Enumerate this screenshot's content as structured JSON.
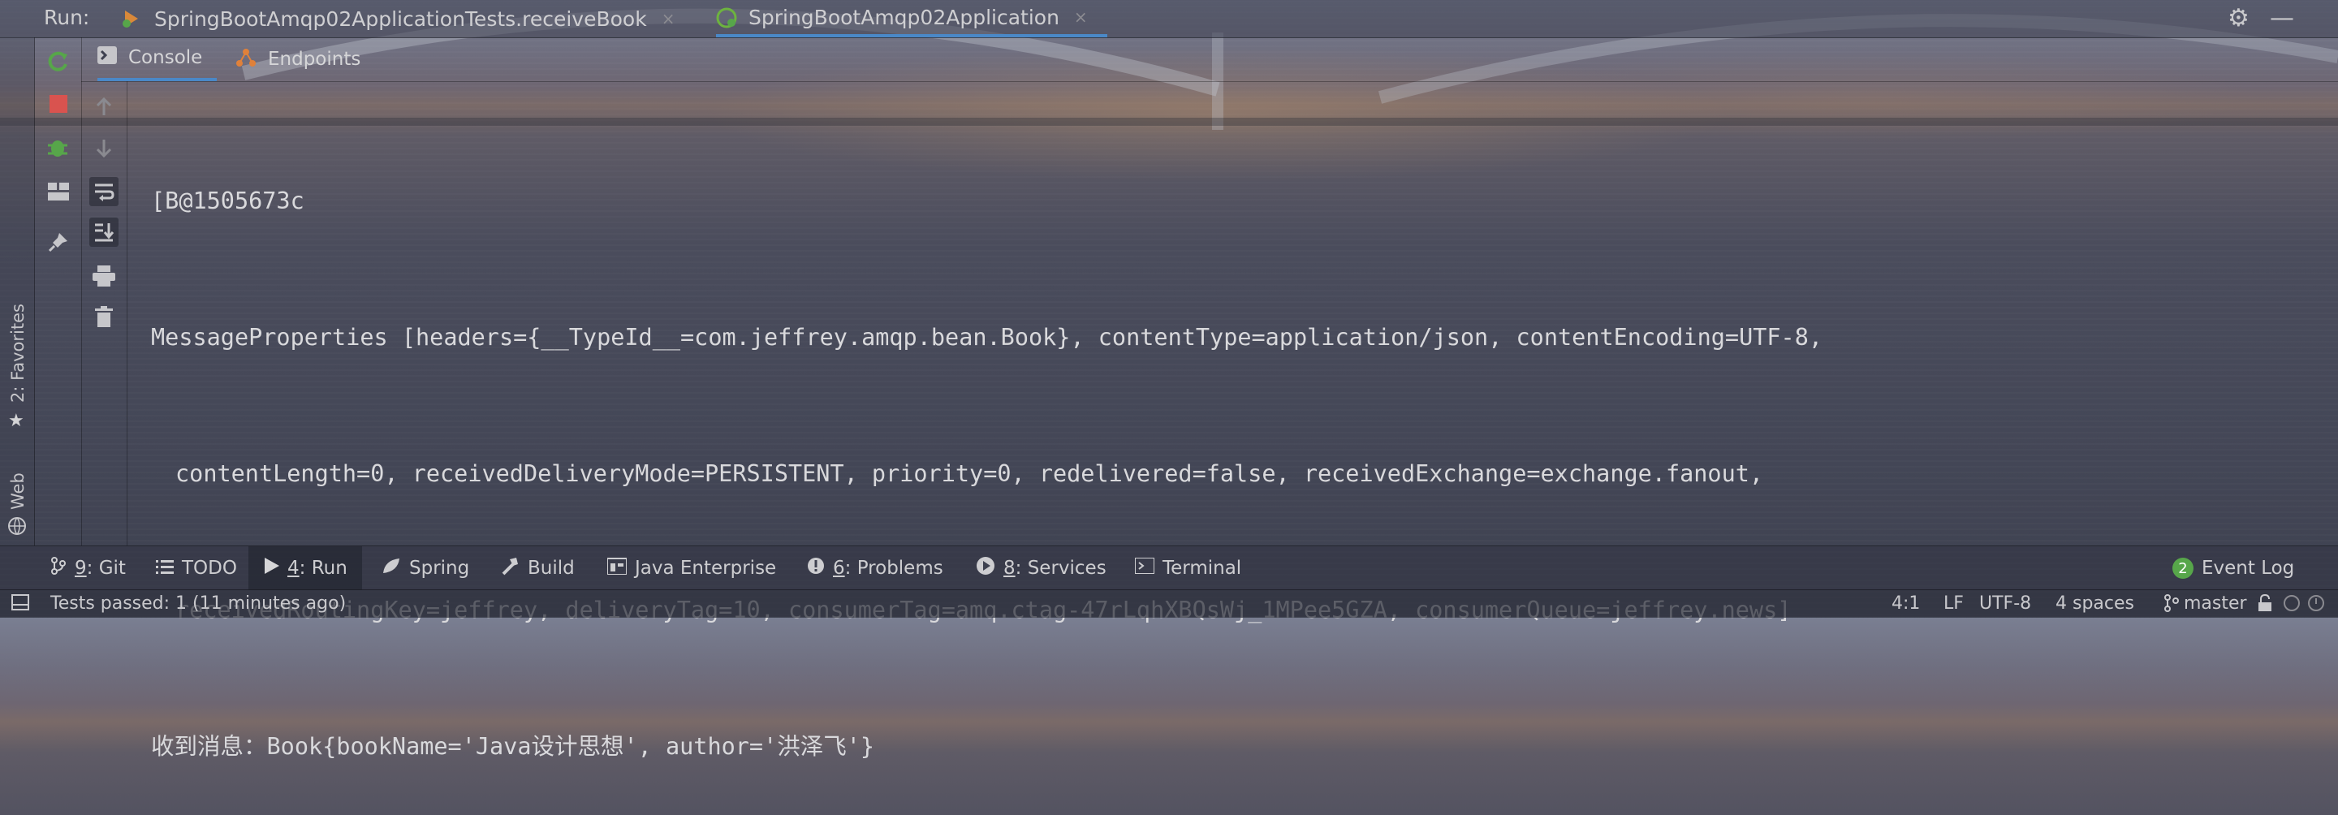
{
  "run_bar": {
    "label": "Run:",
    "tabs": [
      {
        "label": "SpringBootAmqp02ApplicationTests.receiveBook",
        "close": "×",
        "icon": "test-run-icon"
      },
      {
        "label": "SpringBootAmqp02Application",
        "close": "×",
        "icon": "spring-boot-icon",
        "active": true
      }
    ],
    "icons": [
      "gear-icon",
      "minimize-icon"
    ]
  },
  "console_tabs": [
    {
      "label": "Console",
      "icon": "console-icon",
      "active": true
    },
    {
      "label": "Endpoints",
      "icon": "endpoints-icon"
    }
  ],
  "favorites_bar": {
    "favorites": "2: Favorites",
    "web": "Web"
  },
  "console_lines": [
    "[B@1505673c",
    "MessageProperties [headers={__TypeId__=com.jeffrey.amqp.bean.Book}, contentType=application/json, contentEncoding=UTF-8,",
    "contentLength=0, receivedDeliveryMode=PERSISTENT, priority=0, redelivered=false, receivedExchange=exchange.fanout,",
    "receivedRoutingKey=jeffrey, deliveryTag=10, consumerTag=amq.ctag-47rLqhXBQsWj_1MPee5GZA, consumerQueue=jeffrey.news]",
    "收到消息：Book{bookName='Java设计思想', author='洪泽飞'}"
  ],
  "tool_windows": [
    {
      "num": "9",
      "label": ": Git",
      "icon": "git-icon"
    },
    {
      "num": "",
      "label": "TODO",
      "icon": "todo-icon"
    },
    {
      "num": "4",
      "label": ": Run",
      "icon": "run-icon",
      "active": true
    },
    {
      "num": "",
      "label": "Spring",
      "icon": "spring-icon"
    },
    {
      "num": "",
      "label": "Build",
      "icon": "build-icon"
    },
    {
      "num": "",
      "label": "Java Enterprise",
      "icon": "java-enterprise-icon"
    },
    {
      "num": "6",
      "label": ": Problems",
      "icon": "problems-icon"
    },
    {
      "num": "8",
      "label": ": Services",
      "icon": "services-icon"
    },
    {
      "num": "",
      "label": "Terminal",
      "icon": "terminal-icon"
    }
  ],
  "event_log": {
    "count": "2",
    "label": "Event Log"
  },
  "status_bar": {
    "message": "Tests passed: 1 (11 minutes ago)",
    "position": "4:1",
    "line_sep": "LF",
    "encoding": "UTF-8",
    "indent": "4 spaces",
    "branch": "master"
  },
  "colors": {
    "accent": "#4a88c7",
    "stop": "#d9534f",
    "run_green": "#57a64a",
    "spring_green": "#6db33f"
  }
}
